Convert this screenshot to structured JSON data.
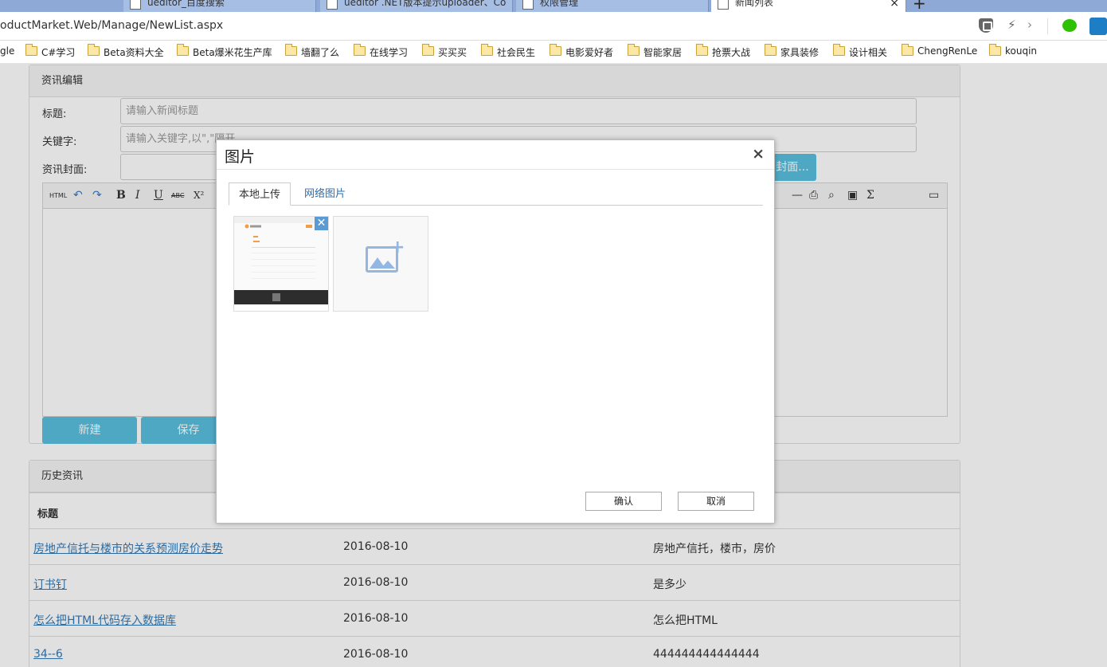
{
  "browser": {
    "tabs": [
      {
        "label": "ueditor_百度搜索"
      },
      {
        "label": "ueditor .NET版本提示uploader、Co"
      },
      {
        "label": "权限管理"
      },
      {
        "label": "新闻列表"
      }
    ],
    "new_tab": "+",
    "close_tab": "×",
    "address": "oductMarket.Web/Manage/NewList.aspx",
    "bookmarks": [
      "gle",
      "C#学习",
      "Beta资料大全",
      "Beta爆米花生产库",
      "墙翻了么",
      "在线学习",
      "买买买",
      "社会民生",
      "电影爱好者",
      "智能家居",
      "抢票大战",
      "家具装修",
      "设计相关",
      "ChengRenLe",
      "kouqin"
    ]
  },
  "editor_panel": {
    "title": "资讯编辑",
    "title_label": "标题:",
    "title_placeholder": "请输入新闻标题",
    "keyword_label": "关键字:",
    "keyword_placeholder": "请输入关键字,以\",\"隔开",
    "cover_label": "资讯封面:",
    "cover_button": "封面...",
    "new_button": "新建",
    "save_button": "保存"
  },
  "toolbar": {
    "html": "HTML",
    "bold": "B",
    "italic": "I",
    "underline": "U",
    "strike": "ABC",
    "superscript": "X²",
    "sigma": "Σ"
  },
  "history_panel": {
    "title": "历史资讯",
    "columns": [
      "标题"
    ],
    "rows": [
      {
        "title": "房地产信托与楼市的关系预测房价走势",
        "date": "2016-08-10",
        "keywords": "房地产信托，楼市，房价"
      },
      {
        "title": "订书钉",
        "date": "2016-08-10",
        "keywords": "是多少"
      },
      {
        "title": "怎么把HTML代码存入数据库",
        "date": "2016-08-10",
        "keywords": "怎么把HTML"
      },
      {
        "title": "34--6",
        "date": "2016-08-10",
        "keywords": "444444444444444"
      }
    ]
  },
  "dialog": {
    "title": "图片",
    "close": "×",
    "tabs": [
      "本地上传",
      "网络图片"
    ],
    "thumb_delete": "✕",
    "add_plus": "+",
    "confirm": "确认",
    "cancel": "取消"
  }
}
